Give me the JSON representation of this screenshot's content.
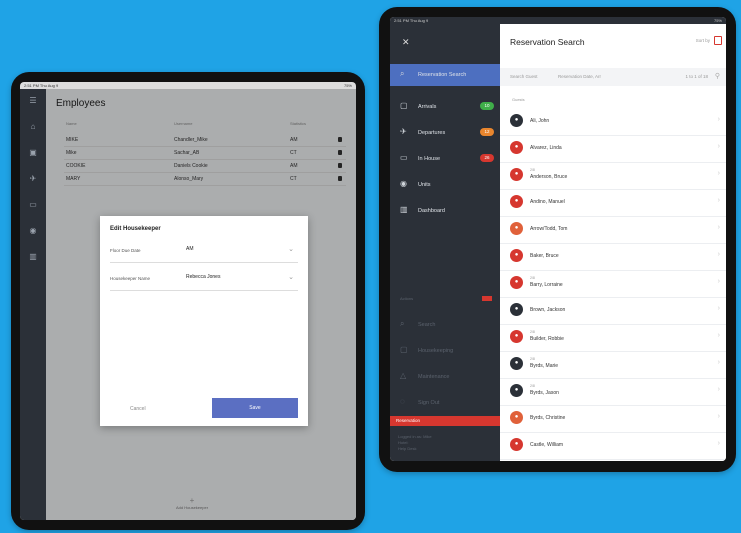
{
  "left_tablet": {
    "status_left": "2:51 PM  Thu Aug 9",
    "status_right": "75%",
    "title": "Employees",
    "columns": [
      "Name",
      "Username",
      "Statistics"
    ],
    "rows": [
      {
        "name": "MIKE",
        "username": "Chandler_Mike",
        "stat": "AM"
      },
      {
        "name": "Mike",
        "username": "Sachar_AB",
        "stat": "CT"
      },
      {
        "name": "COOKIE",
        "username": "Daniels Cookie",
        "stat": "AM"
      },
      {
        "name": "MARY",
        "username": "Alonso_Mary",
        "stat": "CT"
      }
    ],
    "dialog": {
      "title": "Edit Housekeeper",
      "field1_label": "Floor Due Date",
      "field1_value": "AM",
      "field2_label": "Housekeeper Name",
      "field2_value": "Rebecca Jones",
      "cancel": "Cancel",
      "save": "Save"
    },
    "fab_label": "Add Housekeeper"
  },
  "right_tablet": {
    "status_left": "2:51 PM  Thu Aug 9",
    "status_right": "75%",
    "nav": [
      {
        "label": "Reservation Search",
        "icon": "search-icon",
        "badge": "",
        "badge_color": ""
      },
      {
        "label": "Arrivals",
        "icon": "arrival-icon",
        "badge": "10",
        "badge_color": "#3fae49"
      },
      {
        "label": "Departures",
        "icon": "departure-icon",
        "badge": "12",
        "badge_color": "#e9862e"
      },
      {
        "label": "In House",
        "icon": "bed-icon",
        "badge": "26",
        "badge_color": "#d6372f"
      },
      {
        "label": "Units",
        "icon": "unit-icon",
        "badge": "",
        "badge_color": ""
      },
      {
        "label": "Dashboard",
        "icon": "chart-icon",
        "badge": "",
        "badge_color": ""
      }
    ],
    "section_label": "Actions",
    "dim_nav": [
      {
        "label": "Search",
        "icon": "search-icon"
      },
      {
        "label": "Housekeeping",
        "icon": "broom-icon"
      },
      {
        "label": "Maintenance",
        "icon": "wrench-icon"
      },
      {
        "label": "Sign Out",
        "icon": "logout-icon"
      }
    ],
    "red_bar": "Reservation",
    "footer_lines": [
      "Logged in as: Mike",
      "Hotel:",
      "Help Desk"
    ],
    "content_title": "Reservation Search",
    "top_right": "Sort by",
    "search_placeholder": "Search Guest",
    "search_filter": "Reservation Date, Arr",
    "search_count": "1 to 1 of 18",
    "list_header": "Guests",
    "guests": [
      {
        "name": "Ali, John",
        "sub": "",
        "color": "#2b3038"
      },
      {
        "name": "Alvarez, Linda",
        "sub": "",
        "color": "#d6372f"
      },
      {
        "name": "Anderson, Bruce",
        "sub": "2/8",
        "color": "#d6372f"
      },
      {
        "name": "Andino, Manuel",
        "sub": "",
        "color": "#d6372f"
      },
      {
        "name": "Arrow/Todd, Tom",
        "sub": "",
        "color": "#e0613a"
      },
      {
        "name": "Baker, Bruce",
        "sub": "",
        "color": "#d6372f"
      },
      {
        "name": "Barry, Lorraine",
        "sub": "2/8",
        "color": "#d6372f"
      },
      {
        "name": "Brown, Jackson",
        "sub": "",
        "color": "#2b3038"
      },
      {
        "name": "Builder, Robbie",
        "sub": "2/8",
        "color": "#d6372f"
      },
      {
        "name": "Byrds, Marie",
        "sub": "2/8",
        "color": "#2b3038"
      },
      {
        "name": "Byrds, Jason",
        "sub": "2/8",
        "color": "#2b3038"
      },
      {
        "name": "Byrds, Christine",
        "sub": "",
        "color": "#e0613a"
      },
      {
        "name": "Castle, William",
        "sub": "",
        "color": "#d6372f"
      }
    ]
  }
}
